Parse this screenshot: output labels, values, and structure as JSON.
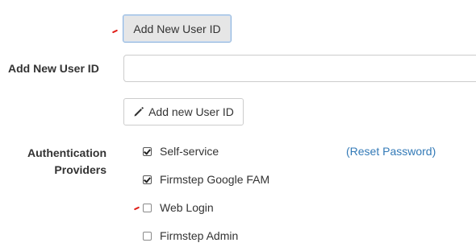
{
  "top_button": {
    "label": "Add New User ID"
  },
  "user_id_field": {
    "label": "Add New User ID",
    "value": "",
    "placeholder": ""
  },
  "add_button": {
    "label": "Add new User ID",
    "icon": "pencil-icon"
  },
  "auth": {
    "label_line1": "Authentication",
    "label_line2": "Providers",
    "reset_link": "(Reset Password)",
    "providers": [
      {
        "label": "Self-service",
        "checked": true
      },
      {
        "label": "Firmstep Google FAM",
        "checked": true
      },
      {
        "label": "Web Login",
        "checked": false
      },
      {
        "label": "Firmstep Admin",
        "checked": false
      }
    ]
  },
  "colors": {
    "link": "#337ab7",
    "annotation_mark": "#e0201a"
  }
}
